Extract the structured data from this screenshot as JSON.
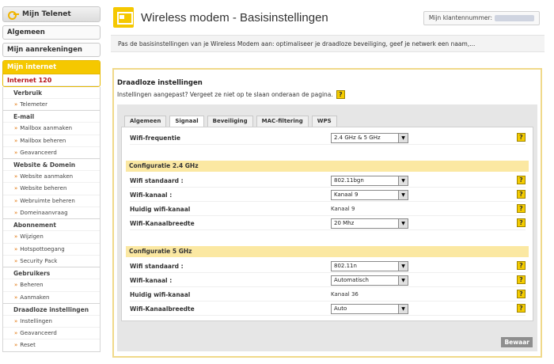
{
  "sidebar": {
    "head_label": "Mijn Telenet",
    "buttons": [
      "Algemeen",
      "Mijn aanrekeningen"
    ],
    "active_title": "Mijn internet",
    "current_sub": "Internet 120",
    "groups": [
      {
        "title": "Verbruik",
        "links": [
          "Telemeter"
        ]
      },
      {
        "title": "E-mail",
        "links": [
          "Mailbox aanmaken",
          "Mailbox beheren",
          "Geavanceerd"
        ]
      },
      {
        "title": "Website & Domein",
        "links": [
          "Website aanmaken",
          "Website beheren",
          "Webruimte beheren",
          "Domeinaanvraag"
        ]
      },
      {
        "title": "Abonnement",
        "links": [
          "Wijzigen",
          "Hotspottoegang",
          "Security Pack"
        ]
      },
      {
        "title": "Gebruikers",
        "links": [
          "Beheren",
          "Aanmaken"
        ]
      },
      {
        "title": "Draadloze instellingen",
        "links": [
          "Instellingen",
          "Geavanceerd",
          "Reset"
        ]
      }
    ]
  },
  "header": {
    "title": "Wireless modem - Basisinstellingen",
    "klant_label": "Mijn klantennummer:"
  },
  "intro": "Pas de basisinstellingen van je Wireless Modem aan: optimaliseer je draadloze beveiliging, geef je netwerk een naam,...",
  "panel": {
    "title": "Draadloze instellingen",
    "subtitle": "Instellingen aangepast? Vergeet ze niet op te slaan onderaan de pagina.",
    "help_label": "?",
    "tabs": [
      "Algemeen",
      "Signaal",
      "Beveiliging",
      "MAC-filtering",
      "WPS"
    ],
    "active_tab": "Signaal",
    "freq_label": "Wifi-frequentie",
    "freq_value": "2.4 GHz & 5 GHz",
    "section24": {
      "title": "Configuratie 2.4 GHz",
      "standaard_label": "Wifi standaard :",
      "standaard_value": "802.11bgn",
      "kanaal_label": "Wifi-kanaal :",
      "kanaal_value": "Kanaal 9",
      "huidig_label": "Huidig wifi-kanaal",
      "huidig_value": "Kanaal 9",
      "breedte_label": "Wifi-Kanaalbreedte",
      "breedte_value": "20 Mhz"
    },
    "section5": {
      "title": "Configuratie 5 GHz",
      "standaard_label": "Wifi standaard :",
      "standaard_value": "802.11n",
      "kanaal_label": "Wifi-kanaal :",
      "kanaal_value": "Automatisch",
      "huidig_label": "Huidig wifi-kanaal",
      "huidig_value": "Kanaal 36",
      "breedte_label": "Wifi-Kanaalbreedte",
      "breedte_value": "Auto"
    },
    "save_label": "Bewaar"
  },
  "colors": {
    "accent": "#f5c800",
    "section_bg": "#fbe8a2",
    "active_link": "#b5121b"
  }
}
